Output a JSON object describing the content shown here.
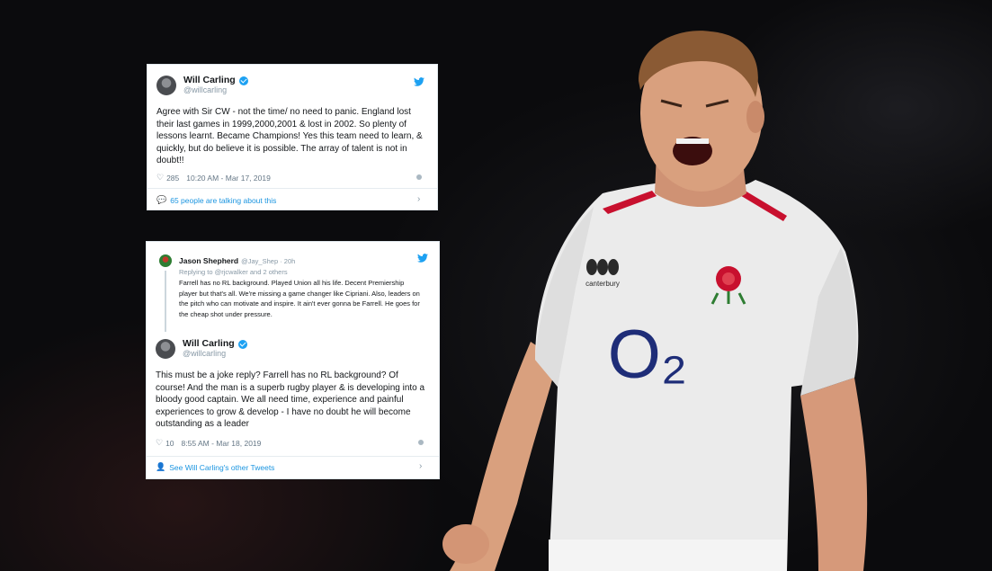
{
  "tweet1": {
    "author_name": "Will Carling",
    "author_handle": "@willcarling",
    "text": "Agree with Sir CW - not the time/ no need to panic. England lost their last games in 1999,2000,2001 & lost in 2002. So plenty of lessons learnt. Became Champions! Yes this team need to learn, & quickly, but do believe it is possible. The array of talent is not in doubt!!",
    "likes": "285",
    "timestamp": "10:20 AM - Mar 17, 2019",
    "footer_link": "65 people are talking about this"
  },
  "tweet2": {
    "reply_to": {
      "author_name": "Jason Shepherd",
      "author_handle": "@Jay_Shep · 20h",
      "replying_to": "Replying to @rjcwalker and 2 others",
      "text": "Farrell has no RL background. Played Union all his life. Decent Premiership player but that's all. We're missing a game changer like Cipriani. Also, leaders on the pitch who can motivate and inspire. It ain't ever gonna be Farrell. He goes for the cheap shot under pressure."
    },
    "author_name": "Will Carling",
    "author_handle": "@willcarling",
    "text": "This must be a joke reply? Farrell has no RL background? Of course! And the man is a superb rugby player & is developing into a bloody good captain. We all need time, experience and painful experiences to grow & develop - I have no doubt he will become outstanding as a leader",
    "likes": "10",
    "timestamp": "8:55 AM - Mar 18, 2019",
    "footer_link": "See Will Carling's other Tweets"
  },
  "jersey": {
    "sponsor": "O₂",
    "kit_brand": "canterbury"
  },
  "colors": {
    "twitter_blue": "#1da1f2",
    "link_blue": "#1b95e0",
    "jersey_red": "#c8102e",
    "o2_navy": "#1e2d78"
  }
}
